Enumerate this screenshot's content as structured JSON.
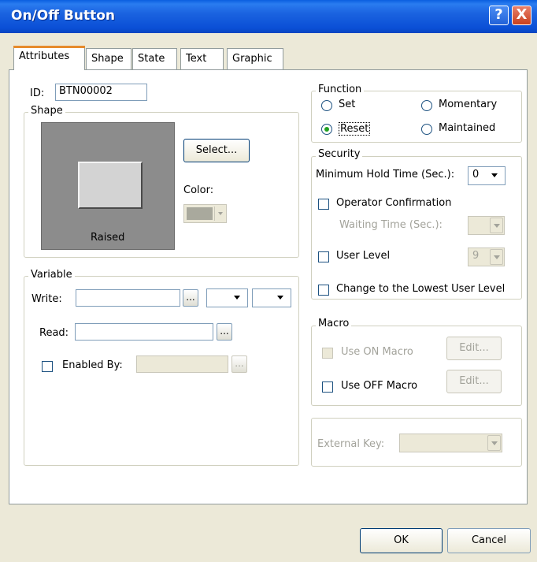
{
  "window": {
    "title": "On/Off Button",
    "help_icon": "?",
    "close_icon": "X"
  },
  "tabs": [
    {
      "label": "Attributes",
      "active": true
    },
    {
      "label": "Shape"
    },
    {
      "label": "State"
    },
    {
      "label": "Text"
    },
    {
      "label": "Graphic"
    }
  ],
  "id": {
    "label": "ID:",
    "value": "BTN00002"
  },
  "shape": {
    "title": "Shape",
    "preview_label": "Raised",
    "select_button": "Select...",
    "color_label": "Color:",
    "color_value": "#a9a99d"
  },
  "variable": {
    "title": "Variable",
    "write_label": "Write:",
    "write_value": "",
    "read_label": "Read:",
    "read_value": "",
    "enabled_by_label": "Enabled By:",
    "enabled_by_value": "",
    "ellipsis": "..."
  },
  "function": {
    "title": "Function",
    "options": [
      {
        "label": "Set",
        "checked": false
      },
      {
        "label": "Momentary",
        "checked": false
      },
      {
        "label": "Reset",
        "checked": true
      },
      {
        "label": "Maintained",
        "checked": false
      }
    ]
  },
  "security": {
    "title": "Security",
    "min_hold_label": "Minimum Hold Time (Sec.):",
    "min_hold_value": "0",
    "operator_confirmation_label": "Operator Confirmation",
    "waiting_time_label": "Waiting Time (Sec.):",
    "waiting_time_value": "",
    "user_level_label": "User Level",
    "user_level_value": "9",
    "lowest_level_label": "Change to the Lowest User Level"
  },
  "macro": {
    "title": "Macro",
    "use_on_label": "Use ON Macro",
    "use_off_label": "Use OFF Macro",
    "edit_label": "Edit..."
  },
  "external_key": {
    "label": "External Key:",
    "value": ""
  },
  "footer": {
    "ok": "OK",
    "cancel": "Cancel"
  }
}
